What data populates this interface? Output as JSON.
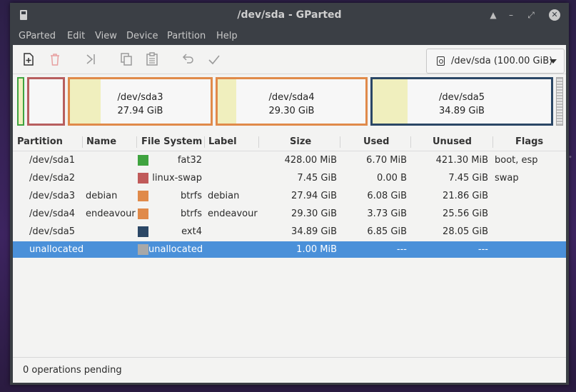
{
  "window": {
    "title": "/dev/sda - GParted"
  },
  "menu": [
    "GParted",
    "Edit",
    "View",
    "Device",
    "Partition",
    "Help"
  ],
  "device_selector": {
    "value": "/dev/sda (100.00 GiB)"
  },
  "graph": [
    {
      "name": "/dev/sda3",
      "size": "27.94 GiB"
    },
    {
      "name": "/dev/sda4",
      "size": "29.30 GiB"
    },
    {
      "name": "/dev/sda5",
      "size": "34.89 GiB"
    }
  ],
  "columns": [
    "Partition",
    "Name",
    "File System",
    "Label",
    "Size",
    "Used",
    "Unused",
    "Flags"
  ],
  "fs_colors": {
    "fat32": "#3fa33f",
    "linux-swap": "#c05a5a",
    "btrfs": "#e08a4a",
    "ext4": "#2b4766",
    "unallocated": "#a8a8a8"
  },
  "rows": [
    {
      "partition": "/dev/sda1",
      "name": "",
      "fs": "fat32",
      "label": "",
      "size": "428.00 MiB",
      "used": "6.70 MiB",
      "unused": "421.30 MiB",
      "flags": "boot, esp"
    },
    {
      "partition": "/dev/sda2",
      "name": "",
      "fs": "linux-swap",
      "label": "",
      "size": "7.45 GiB",
      "used": "0.00 B",
      "unused": "7.45 GiB",
      "flags": "swap"
    },
    {
      "partition": "/dev/sda3",
      "name": "debian",
      "fs": "btrfs",
      "label": "debian",
      "size": "27.94 GiB",
      "used": "6.08 GiB",
      "unused": "21.86 GiB",
      "flags": ""
    },
    {
      "partition": "/dev/sda4",
      "name": "endeavour",
      "fs": "btrfs",
      "label": "endeavour",
      "size": "29.30 GiB",
      "used": "3.73 GiB",
      "unused": "25.56 GiB",
      "flags": ""
    },
    {
      "partition": "/dev/sda5",
      "name": "",
      "fs": "ext4",
      "label": "",
      "size": "34.89 GiB",
      "used": "6.85 GiB",
      "unused": "28.05 GiB",
      "flags": ""
    },
    {
      "partition": "unallocated",
      "name": "",
      "fs": "unallocated",
      "label": "",
      "size": "1.00 MiB",
      "used": "---",
      "unused": "---",
      "flags": ""
    }
  ],
  "status": "0 operations pending"
}
